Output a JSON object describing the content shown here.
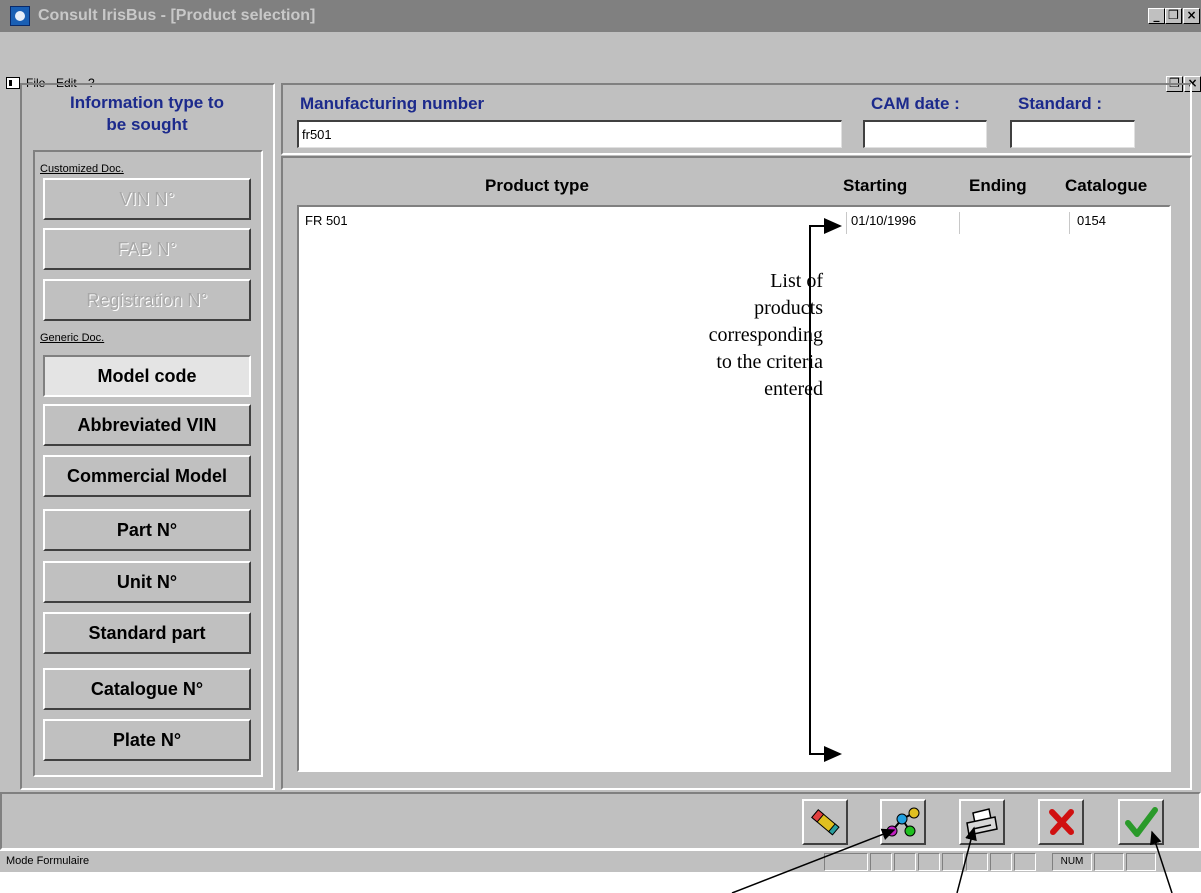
{
  "window": {
    "title": "Consult IrisBus - [Product selection]",
    "controls": {
      "minimize": "_",
      "maximize": "❒",
      "close": "×"
    }
  },
  "menu": {
    "items": [
      {
        "label": "File"
      },
      {
        "label": "Edit"
      },
      {
        "label": "?"
      }
    ]
  },
  "left_panel": {
    "heading_line1": "Information type to",
    "heading_line2": "be sought",
    "customized_label": "Customized Doc.",
    "generic_label": "Generic Doc.",
    "customized_buttons": [
      {
        "label": "VIN N°",
        "enabled": false
      },
      {
        "label": "FAB N°",
        "enabled": false
      },
      {
        "label": "Registration N°",
        "enabled": false
      }
    ],
    "generic_buttons": [
      {
        "label": "Model code",
        "selected": true
      },
      {
        "label": "Abbreviated VIN"
      },
      {
        "label": "Commercial Model"
      },
      {
        "label": "Part N°"
      },
      {
        "label": "Unit N°"
      },
      {
        "label": "Standard part"
      },
      {
        "label": "Catalogue N°"
      },
      {
        "label": "Plate N°"
      }
    ]
  },
  "search": {
    "manufacturing_number_label": "Manufacturing number",
    "manufacturing_number_value": "fr501",
    "cam_date_label": "CAM date :",
    "cam_date_value": "",
    "standard_label": "Standard :",
    "standard_value": ""
  },
  "results": {
    "columns": [
      "Product type",
      "Starting",
      "Ending",
      "Catalogue"
    ],
    "rows": [
      {
        "product_type": "FR 501",
        "starting": "01/10/1996",
        "ending": "",
        "catalogue": "0154"
      }
    ]
  },
  "annotation": {
    "lines": [
      "List of",
      "products",
      "corresponding",
      "to the criteria",
      "entered"
    ]
  },
  "toolbar": {
    "buttons": [
      {
        "icon": "eraser-icon"
      },
      {
        "icon": "molecule-icon"
      },
      {
        "icon": "printer-icon"
      },
      {
        "icon": "cancel-x-icon"
      },
      {
        "icon": "validate-check-icon"
      }
    ]
  },
  "statusbar": {
    "text": "Mode Formulaire",
    "indicator": "NUM"
  },
  "colors": {
    "window_bg": "#c0c0c0",
    "label_blue": "#1c2a8c",
    "cancel_red": "#d01010",
    "check_green": "#2a9a2a"
  }
}
